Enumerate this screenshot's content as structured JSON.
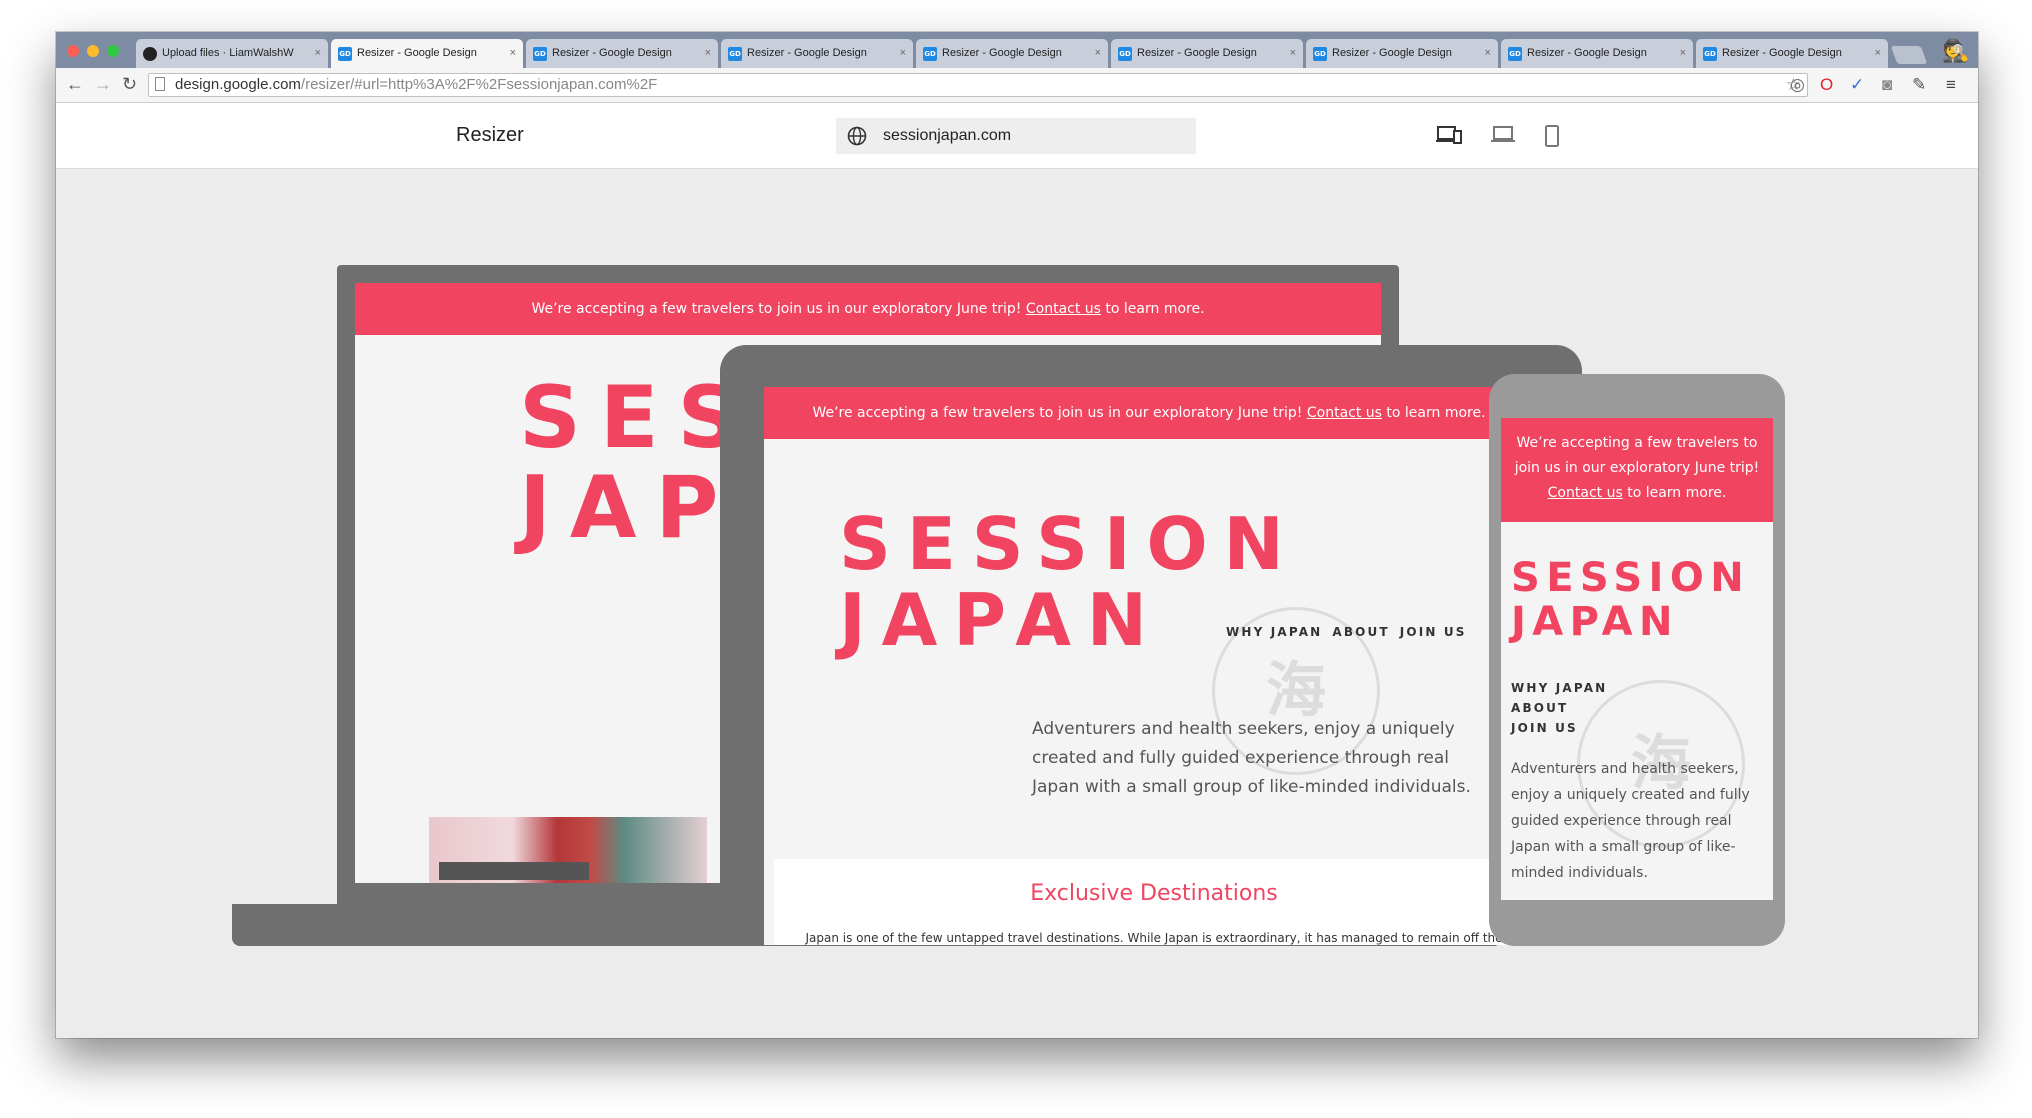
{
  "browser": {
    "tabs": [
      {
        "label": "Upload files · LiamWalshW",
        "close": "×",
        "icon": "github-icon"
      },
      {
        "label": "Resizer - Google Design",
        "close": "×",
        "icon": "google-design-icon",
        "favicon_text": "GD"
      },
      {
        "label": "Resizer - Google Design",
        "close": "×",
        "icon": "google-design-icon",
        "favicon_text": "GD"
      },
      {
        "label": "Resizer - Google Design",
        "close": "×",
        "icon": "google-design-icon",
        "favicon_text": "GD"
      },
      {
        "label": "Resizer - Google Design",
        "close": "×",
        "icon": "google-design-icon",
        "favicon_text": "GD"
      },
      {
        "label": "Resizer - Google Design",
        "close": "×",
        "icon": "google-design-icon",
        "favicon_text": "GD"
      },
      {
        "label": "Resizer - Google Design",
        "close": "×",
        "icon": "google-design-icon",
        "favicon_text": "GD"
      },
      {
        "label": "Resizer - Google Design",
        "close": "×",
        "icon": "google-design-icon",
        "favicon_text": "GD"
      },
      {
        "label": "Resizer - Google Design",
        "close": "×",
        "icon": "google-design-icon",
        "favicon_text": "GD"
      }
    ],
    "active_tab": 1,
    "url_host": "design.google.com",
    "url_rest": "/resizer/#url=http%3A%2F%2Fsessionjapan.com%2F"
  },
  "app": {
    "title": "Resizer",
    "url_value": "sessionjapan.com",
    "devices": [
      "all-devices-icon",
      "laptop-icon",
      "phone-icon"
    ]
  },
  "site": {
    "banner_pre": "We’re accepting a few travelers to join us in our exploratory June trip! ",
    "banner_link": "Contact us",
    "banner_post": " to learn more.",
    "brand_line1": "SESSION",
    "brand_line2": "JAPAN",
    "desk_line1": "SES",
    "desk_line2": "JAP",
    "nav": [
      "WHY JAPAN",
      "ABOUT",
      "JOIN US"
    ],
    "stamp_text": "海",
    "intro": "Adventurers and health seekers, enjoy a uniquely created and fully guided experience through real Japan with a small group of like-minded individuals.",
    "section_title": "Exclusive Destinations",
    "section_text": "Japan is one of the few untapped travel destinations. While Japan is extraordinary, it has managed to remain off the map to international travelers, until now."
  },
  "colors": {
    "brand": "#f04460",
    "frame": "#6f6f6f",
    "phone_frame": "#9a9a9a",
    "stage_bg": "#ececec"
  }
}
